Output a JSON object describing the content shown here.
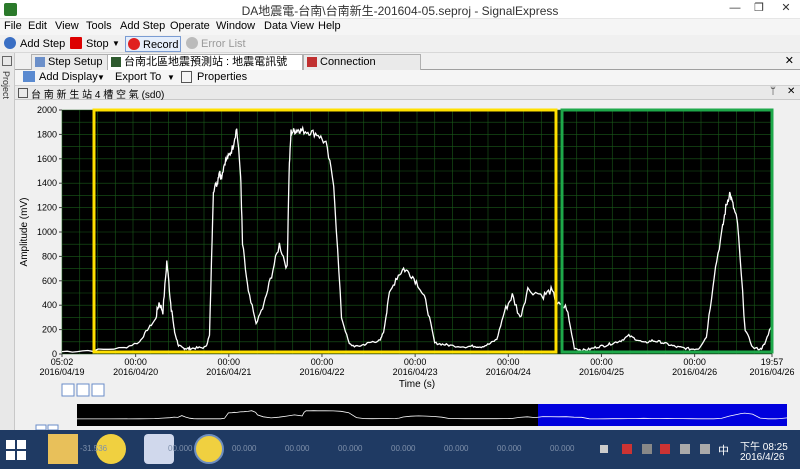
{
  "window": {
    "title": "DA地震電-台南\\台南新生-201604-05.seproj - SignalExpress",
    "min": "—",
    "max": "❐",
    "close": "✕"
  },
  "menu": [
    "File",
    "Edit",
    "View",
    "Tools",
    "Add Step",
    "Operate",
    "Window",
    "Data View",
    "Help"
  ],
  "toolbar": {
    "add_step": "Add Step",
    "stop": "Stop",
    "record": "Record",
    "error_list": "Error List"
  },
  "side_panel": {
    "label": "Project"
  },
  "tabs": [
    {
      "label": "Step Setup"
    },
    {
      "label": "台南北區地震預測站 : 地震電訊號"
    },
    {
      "label": "Connection Diagram"
    }
  ],
  "display_toolbar": {
    "add_display": "Add Display",
    "export_to": "Export To",
    "properties": "Properties"
  },
  "display": {
    "name": "台 南 新 生 站 4 槽 空 氣 (sd0)",
    "pin": "ᛘ",
    "close": "✕"
  },
  "colors": {
    "plot_bg": "#000000",
    "grid": "#1a5a1a",
    "trace": "#ffffff",
    "highlight_yellow": "#ffe000",
    "highlight_green": "#1ea84a",
    "overview_cursor": "#0000dd",
    "taskbar": "#1f3a63"
  },
  "chart_data": {
    "type": "line",
    "ylabel": "Amplitude (mV)",
    "xlabel": "Time (s)",
    "ylim": [
      0,
      2000
    ],
    "yticks": [
      "0",
      "200",
      "400",
      "600",
      "800",
      "1000",
      "1200",
      "1400",
      "1600",
      "1800",
      "2000"
    ],
    "xticks": [
      {
        "t": 0,
        "time": "05:02",
        "date": "2016/04/19"
      },
      {
        "t": 18.97,
        "time": "00:00",
        "date": "2016/04/20"
      },
      {
        "t": 42.97,
        "time": "00:00",
        "date": "2016/04/21"
      },
      {
        "t": 66.97,
        "time": "00:00",
        "date": "2016/04/22"
      },
      {
        "t": 90.97,
        "time": "00:00",
        "date": "2016/04/23"
      },
      {
        "t": 114.97,
        "time": "00:00",
        "date": "2016/04/24"
      },
      {
        "t": 138.97,
        "time": "00:00",
        "date": "2016/04/25"
      },
      {
        "t": 162.97,
        "time": "00:00",
        "date": "2016/04/26"
      },
      {
        "t": 182.9,
        "time": "19:57",
        "date": "2016/04/26"
      }
    ],
    "xlim": [
      0,
      182.9
    ],
    "series": [
      {
        "t": [
          0,
          8,
          16,
          20,
          22,
          24,
          25,
          26,
          27,
          28,
          28.5,
          29,
          30,
          31,
          32,
          33,
          35,
          37,
          38,
          39,
          40,
          40.5,
          41,
          42,
          43,
          44,
          45,
          46,
          46.5,
          48,
          50,
          52,
          54,
          56,
          58,
          58.5,
          59,
          60,
          61,
          62,
          64,
          66,
          68,
          70,
          72,
          74,
          76,
          78,
          80,
          82,
          83,
          84,
          86,
          88,
          90,
          92,
          94,
          96,
          98,
          100,
          104,
          106,
          108,
          110,
          112,
          114,
          116,
          118,
          120,
          124,
          126,
          128,
          130,
          132,
          134,
          136,
          138,
          140,
          142,
          144,
          146,
          148,
          150,
          152,
          154,
          156,
          158,
          160,
          162,
          164,
          166,
          168,
          170,
          171,
          172,
          173,
          174,
          176,
          178,
          180,
          181,
          182.9
        ],
        "y": [
          20,
          30,
          50,
          100,
          200,
          280,
          420,
          350,
          760,
          420,
          300,
          180,
          70,
          50,
          45,
          45,
          50,
          55,
          150,
          1350,
          1400,
          1500,
          1450,
          1580,
          1620,
          1700,
          1850,
          1480,
          900,
          500,
          250,
          400,
          650,
          900,
          700,
          1500,
          1820,
          1830,
          1840,
          1830,
          1820,
          1800,
          1720,
          1400,
          300,
          80,
          60,
          80,
          100,
          110,
          200,
          450,
          620,
          700,
          650,
          560,
          400,
          90,
          80,
          70,
          60,
          65,
          60,
          80,
          120,
          350,
          480,
          300,
          530,
          480,
          520,
          400,
          380,
          50,
          30,
          40,
          60,
          70,
          90,
          110,
          150,
          120,
          90,
          110,
          100,
          80,
          60,
          50,
          40,
          45,
          140,
          650,
          1000,
          1200,
          1320,
          1200,
          1080,
          200,
          50,
          40,
          80,
          250
        ]
      }
    ],
    "highlights": [
      {
        "color": "yellow",
        "from": 0,
        "to": 0
      },
      {
        "color": "green",
        "from": 0,
        "to": 0
      }
    ]
  },
  "overview": {
    "ticks": [
      "-31.536",
      "00.000",
      "00.000",
      "00.000",
      "00.000",
      "00.000",
      "00.000",
      "00.000",
      "00.000",
      "00.000",
      "00.000",
      "00.000",
      "00.000",
      "00.000",
      "00.000",
      "00.000"
    ]
  },
  "taskbar": {
    "time": "下午 08:25",
    "date": "2016/4/26",
    "ime": "中"
  }
}
